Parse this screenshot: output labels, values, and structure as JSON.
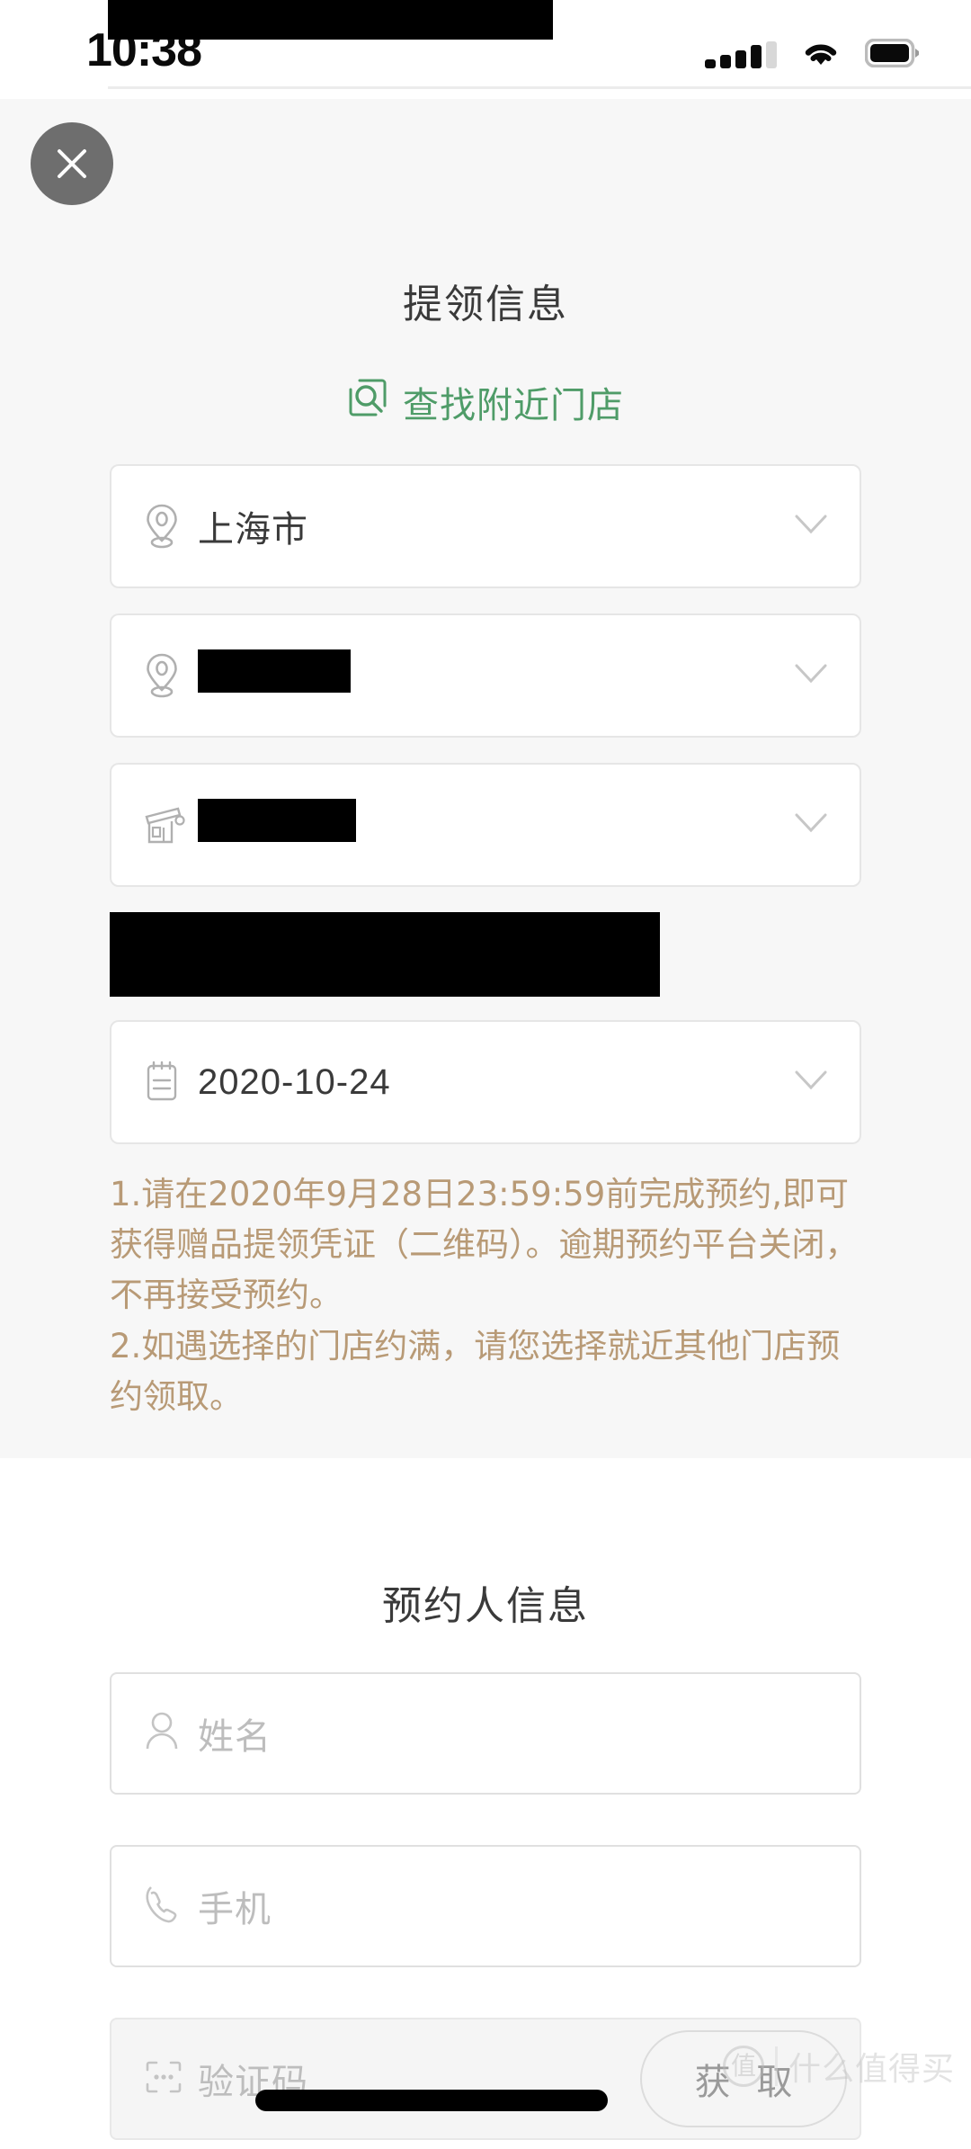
{
  "status_bar": {
    "time": "10:38",
    "signal_icon": "signal-bars-icon",
    "wifi_icon": "wifi-icon",
    "battery_icon": "battery-icon"
  },
  "pickup": {
    "close_icon": "close-icon",
    "title": "提领信息",
    "find_store_label": "查找附近门店",
    "find_store_icon": "search-box-icon",
    "accent_green": "#4f9c68",
    "fields": [
      {
        "icon": "location-pin-icon",
        "value": "上海市",
        "redacted": false,
        "chevron": "chevron-down-icon"
      },
      {
        "icon": "location-pin-icon",
        "value": "",
        "redacted": true,
        "chevron": "chevron-down-icon"
      },
      {
        "icon": "storefront-icon",
        "value": "",
        "redacted": true,
        "chevron": "chevron-down-icon"
      },
      {
        "icon": "calendar-icon",
        "value": "2020-10-24",
        "redacted": false,
        "chevron": "chevron-down-icon"
      }
    ],
    "notice_color": "#b89a76",
    "notice": [
      "1.请在2020年9月28日23:59:59前完成预约,即可获得赠品提领凭证（二维码）。逾期预约平台关闭，不再接受预约。",
      "2.如遇选择的门店约满，请您选择就近其他门店预约领取。"
    ]
  },
  "booker": {
    "title": "预约人信息",
    "name_field": {
      "icon": "person-icon",
      "placeholder": "姓名",
      "value": ""
    },
    "phone_field": {
      "icon": "phone-icon",
      "placeholder": "手机",
      "value": ""
    },
    "code_field": {
      "icon": "code-box-icon",
      "placeholder": "验证码",
      "value": ""
    },
    "get_code_label": "获 取"
  },
  "watermark": {
    "logo": "值",
    "text": "什么值得买"
  }
}
